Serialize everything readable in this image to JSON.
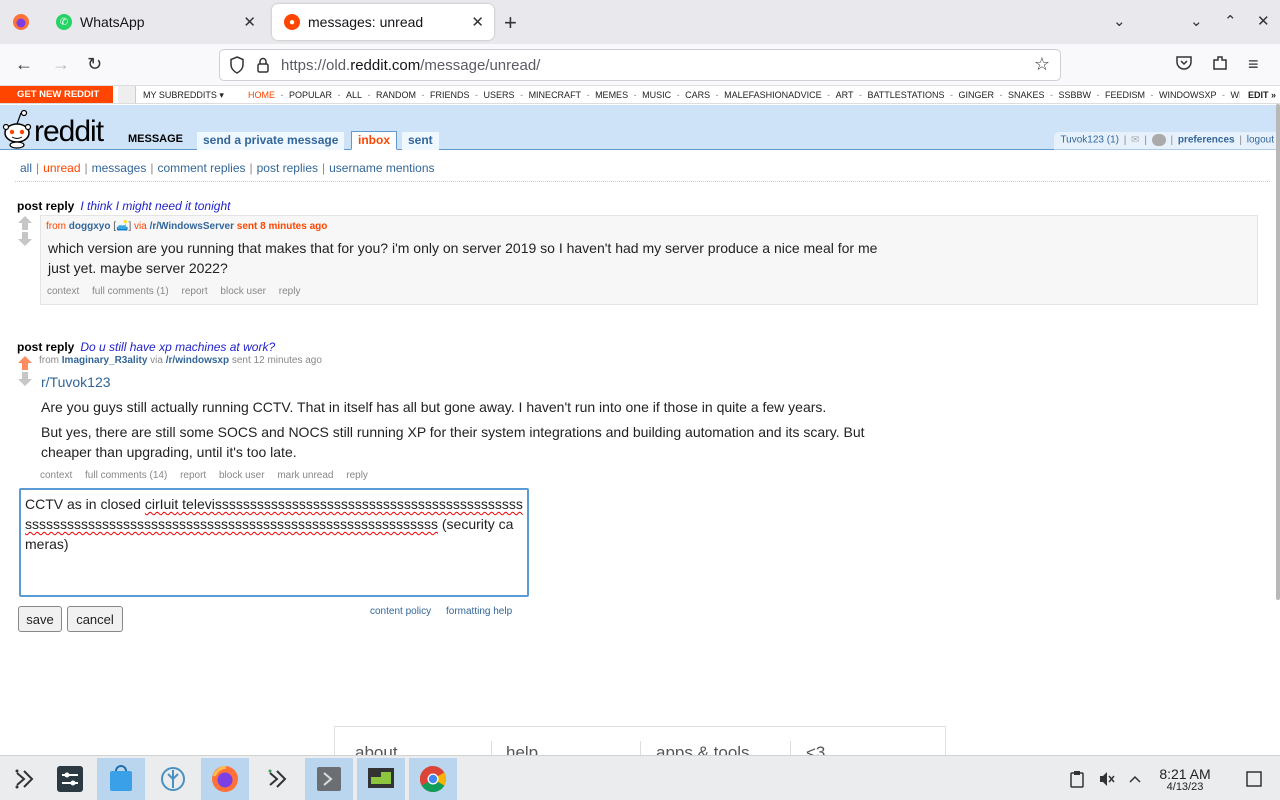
{
  "browser": {
    "tabs": [
      {
        "title": "WhatsApp",
        "active": false
      },
      {
        "title": "messages: unread",
        "active": true
      }
    ],
    "url_prefix": "https://old.",
    "url_domain": "reddit.com",
    "url_path": "/message/unread/"
  },
  "srbar": {
    "get_new": "GET NEW REDDIT",
    "my_subreddits": "MY SUBREDDITS",
    "links": [
      "HOME",
      "POPULAR",
      "ALL",
      "RANDOM",
      "FRIENDS",
      "USERS",
      "MINECRAFT",
      "MEMES",
      "MUSIC",
      "CARS",
      "MALEFASHIONADVICE",
      "ART",
      "BATTLESTATIONS",
      "GINGER",
      "SNAKES",
      "SSBBW",
      "FEEDISM",
      "WINDOWSXP",
      "WINDOWSERVE"
    ],
    "edit": "EDIT »"
  },
  "header": {
    "logo_text": "reddit",
    "page_name": "MESSAGE",
    "tabs": [
      "send a private message",
      "inbox",
      "sent"
    ],
    "user": "Tuvok123",
    "karma": "(1)",
    "preferences": "preferences",
    "logout": "logout"
  },
  "msgnav": {
    "items": [
      "all",
      "unread",
      "messages",
      "comment replies",
      "post replies",
      "username mentions"
    ],
    "selected": "unread"
  },
  "messages": [
    {
      "type": "post reply",
      "title": "I think I might need it tonight",
      "from_label": "from",
      "author": "doggxyo",
      "flair": "[🛋️]",
      "via_label": "via",
      "subreddit": "/r/WindowsServer",
      "time": "sent 8 minutes ago",
      "body": [
        "which version are you running that makes that for you? i'm only on server 2019 so I haven't had my server produce a nice meal for me just yet. maybe server 2022?"
      ],
      "buttons": [
        "context",
        "full comments (1)",
        "report",
        "block user",
        "reply"
      ]
    },
    {
      "type": "post reply",
      "title": "Do u still have xp machines at work?",
      "from_label": "from",
      "author": "Imaginary_R3ality",
      "via_label": "via",
      "subreddit": "/r/windowsxp",
      "time": "sent 12 minutes ago",
      "quote_link": "r/Tuvok123",
      "body": [
        "Are you guys still actually running CCTV. That in itself has all but gone away. I haven't run into one if those in quite a few years.",
        "But yes, there are still some SOCS and NOCS still running XP for their system integrations and building automation and its scary. But cheaper than upgrading, until it's too late."
      ],
      "buttons": [
        "context",
        "full comments (14)",
        "report",
        "block user",
        "mark unread",
        "reply"
      ]
    }
  ],
  "reply": {
    "text_a": "CCTV as in closed ",
    "text_b": "cirIuit",
    "text_c": " televisssssssssssssssssssssssssssssssssssssssssssssssssssssssssssssssssssssssssssssssssssssssssssssssssssssss",
    "text_d": " (security cameras)",
    "save": "save",
    "cancel": "cancel",
    "content_policy": "content policy",
    "formatting_help": "formatting help"
  },
  "footer": {
    "cols": [
      "about",
      "help",
      "apps & tools",
      "<3"
    ]
  },
  "taskbar": {
    "time": "8:21 AM",
    "date": "4/13/23"
  },
  "colors": {
    "accent": "#ff4500",
    "link": "#336699",
    "header_bg": "#cee3f8"
  }
}
